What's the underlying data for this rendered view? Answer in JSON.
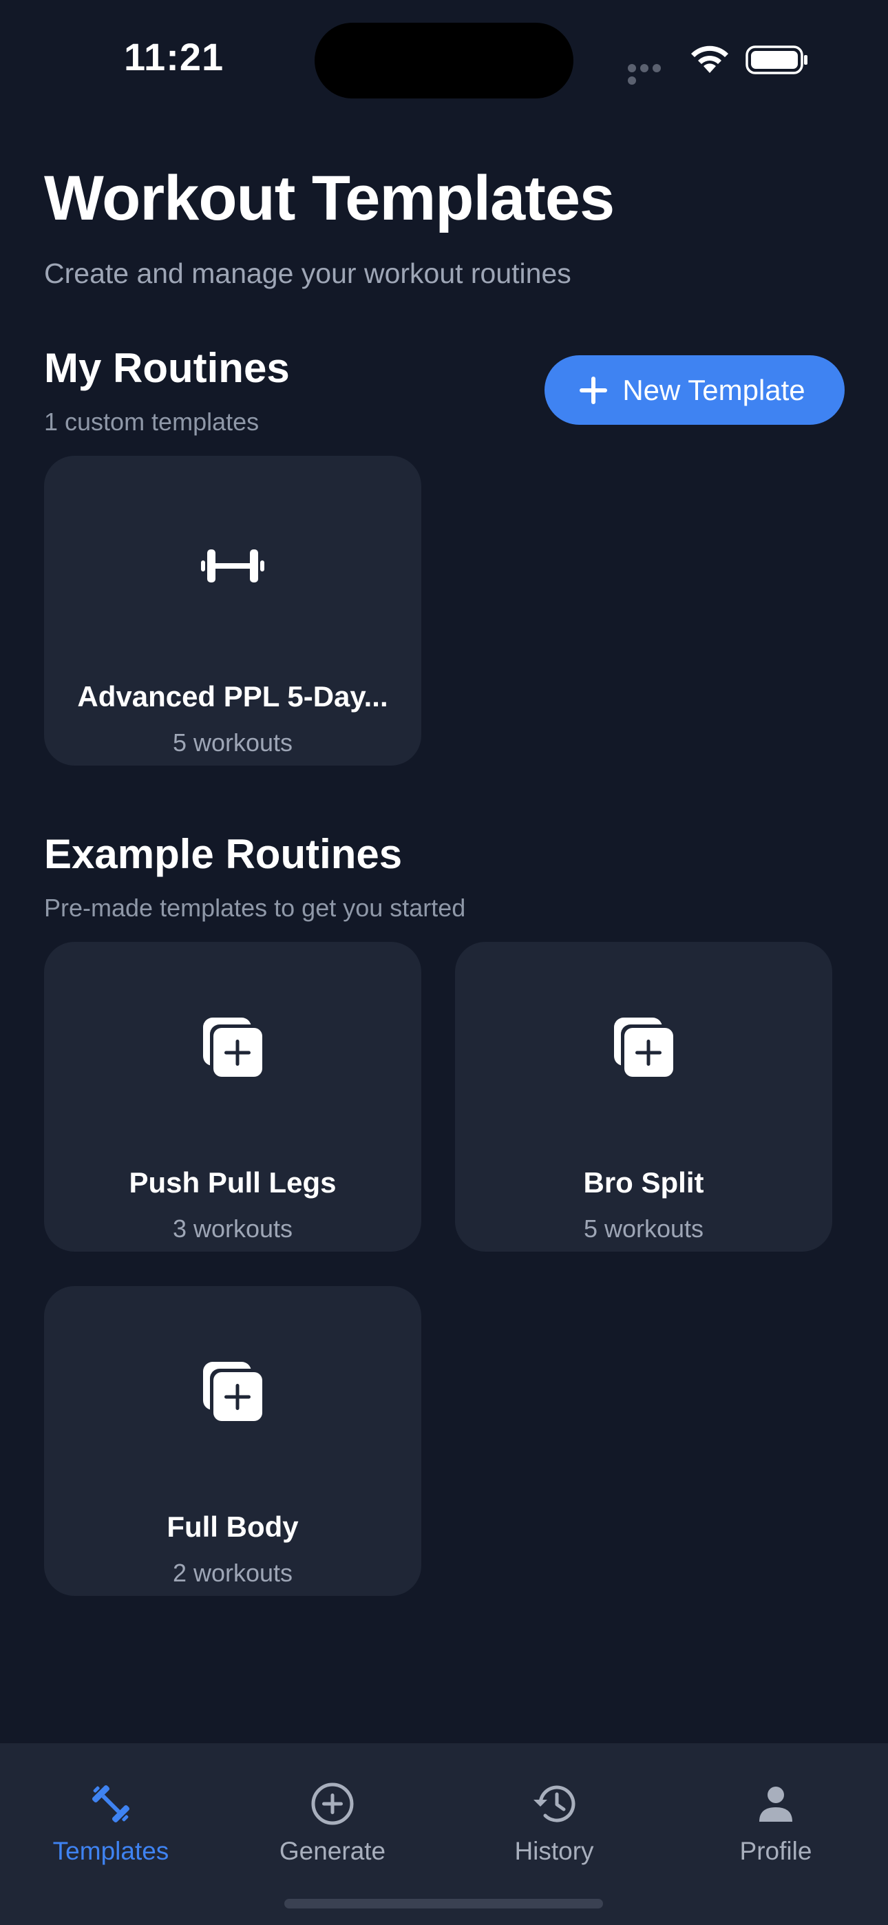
{
  "status_bar": {
    "time": "11:21"
  },
  "header": {
    "title": "Workout Templates",
    "subtitle": "Create and manage your workout routines"
  },
  "my_routines": {
    "title": "My Routines",
    "subtitle": "1 custom templates",
    "new_button_label": "New Template",
    "cards": [
      {
        "name": "Advanced PPL 5-Day...",
        "count": "5 workouts",
        "icon": "dumbbell-icon"
      }
    ]
  },
  "example_routines": {
    "title": "Example Routines",
    "subtitle": "Pre-made templates to get you started",
    "cards": [
      {
        "name": "Push Pull Legs",
        "count": "3 workouts",
        "icon": "add-copy-icon"
      },
      {
        "name": "Bro Split",
        "count": "5 workouts",
        "icon": "add-copy-icon"
      },
      {
        "name": "Full Body",
        "count": "2 workouts",
        "icon": "add-copy-icon"
      }
    ]
  },
  "tab_bar": {
    "active": "Templates",
    "tabs": [
      {
        "label": "Templates",
        "icon": "dumbbell-icon"
      },
      {
        "label": "Generate",
        "icon": "plus-circle-icon"
      },
      {
        "label": "History",
        "icon": "history-icon"
      },
      {
        "label": "Profile",
        "icon": "person-icon"
      }
    ]
  },
  "colors": {
    "background": "#121827",
    "card": "#1f2636",
    "accent": "#3f83f2",
    "secondary_text": "#9ea6b6"
  }
}
